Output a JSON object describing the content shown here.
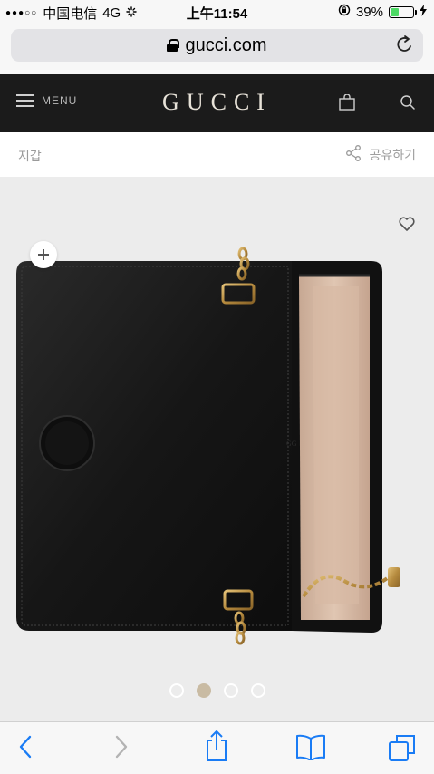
{
  "status_bar": {
    "signal": "●●●○○",
    "carrier": "中国电信",
    "network": "4G",
    "time": "上午11:54",
    "battery_percent": "39%",
    "battery_level": 0.39
  },
  "browser": {
    "url": "gucci.com"
  },
  "header": {
    "menu_label": "MENU",
    "logo": "GUCCI"
  },
  "breadcrumb": {
    "category": "지갑",
    "share_label": "공유하기"
  },
  "gallery": {
    "slide_count": 4,
    "active_index": 1
  },
  "colors": {
    "header_bg": "#1b1b1b",
    "gallery_bg": "#ececec",
    "active_dot": "#c9bba3",
    "ios_blue": "#1a7cf5"
  }
}
